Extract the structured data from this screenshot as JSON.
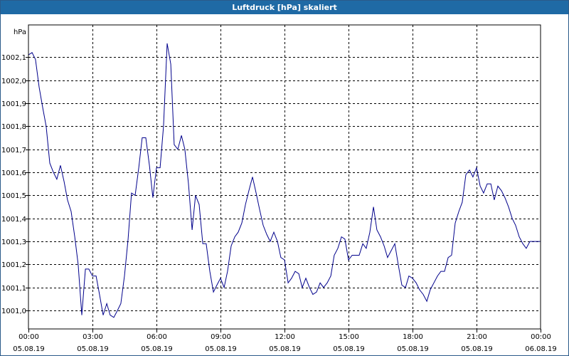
{
  "window": {
    "title": "Luftdruck [hPa] skaliert"
  },
  "chart_data": {
    "type": "line",
    "title": "Luftdruck [hPa] skaliert",
    "ylabel": "hPa",
    "xlabel": "",
    "xlim_hours": [
      0,
      24
    ],
    "ylim": [
      1000.92,
      1002.24
    ],
    "grid": true,
    "y_ticks": [
      {
        "value": 1001.0,
        "label": "1001,0"
      },
      {
        "value": 1001.1,
        "label": "1001,1"
      },
      {
        "value": 1001.2,
        "label": "1001,2"
      },
      {
        "value": 1001.3,
        "label": "1001,3"
      },
      {
        "value": 1001.4,
        "label": "1001,4"
      },
      {
        "value": 1001.5,
        "label": "1001,5"
      },
      {
        "value": 1001.6,
        "label": "1001,6"
      },
      {
        "value": 1001.7,
        "label": "1001,7"
      },
      {
        "value": 1001.8,
        "label": "1001,8"
      },
      {
        "value": 1001.9,
        "label": "1001,9"
      },
      {
        "value": 1002.0,
        "label": "1002,0"
      },
      {
        "value": 1002.1,
        "label": "1002,1"
      }
    ],
    "x_ticks": [
      {
        "hour": 0,
        "time": "00:00",
        "date": "05.08.19"
      },
      {
        "hour": 3,
        "time": "03:00",
        "date": "05.08.19"
      },
      {
        "hour": 6,
        "time": "06:00",
        "date": "05.08.19"
      },
      {
        "hour": 9,
        "time": "09:00",
        "date": "05.08.19"
      },
      {
        "hour": 12,
        "time": "12:00",
        "date": "05.08.19"
      },
      {
        "hour": 15,
        "time": "15:00",
        "date": "05.08.19"
      },
      {
        "hour": 18,
        "time": "18:00",
        "date": "05.08.19"
      },
      {
        "hour": 21,
        "time": "21:00",
        "date": "05.08.19"
      },
      {
        "hour": 24,
        "time": "00:00",
        "date": "06.08.19"
      }
    ],
    "line_color": "#00008b",
    "series": [
      {
        "x": [
          0,
          0.17,
          0.33,
          0.5,
          0.67,
          0.83,
          1.0,
          1.17,
          1.33,
          1.5,
          1.67,
          1.83,
          2.0,
          2.17,
          2.33,
          2.5,
          2.67,
          2.83,
          3.0,
          3.17,
          3.33,
          3.5,
          3.67,
          3.83,
          4.0,
          4.17,
          4.33,
          4.5,
          4.67,
          4.83,
          5.0,
          5.17,
          5.33,
          5.5,
          5.67,
          5.83,
          6.0,
          6.17,
          6.33,
          6.5,
          6.67,
          6.83,
          7.0,
          7.17,
          7.33,
          7.5,
          7.67,
          7.83,
          8.0,
          8.17,
          8.33,
          8.5,
          8.67,
          8.83,
          9.0,
          9.17,
          9.33,
          9.5,
          9.67,
          9.83,
          10.0,
          10.17,
          10.33,
          10.5,
          10.67,
          10.83,
          11.0,
          11.17,
          11.33,
          11.5,
          11.67,
          11.83,
          12.0,
          12.17,
          12.33,
          12.5,
          12.67,
          12.83,
          13.0,
          13.17,
          13.33,
          13.5,
          13.67,
          13.83,
          14.0,
          14.17,
          14.33,
          14.5,
          14.67,
          14.83,
          15.0,
          15.17,
          15.33,
          15.5,
          15.67,
          15.83,
          16.0,
          16.17,
          16.33,
          16.5,
          16.67,
          16.83,
          17.0,
          17.17,
          17.33,
          17.5,
          17.67,
          17.83,
          18.0,
          18.17,
          18.33,
          18.5,
          18.67,
          18.83,
          19.0,
          19.17,
          19.33,
          19.5,
          19.67,
          19.83,
          20.0,
          20.17,
          20.33,
          20.5,
          20.67,
          20.83,
          21.0,
          21.17,
          21.33,
          21.5,
          21.67,
          21.83,
          22.0,
          22.17,
          22.33,
          22.5,
          22.67,
          22.83,
          23.0,
          23.17,
          23.33,
          23.5,
          23.67,
          23.83,
          24.0
        ],
        "y": [
          1002.11,
          1002.12,
          1002.09,
          1001.97,
          1001.88,
          1001.8,
          1001.64,
          1001.6,
          1001.57,
          1001.63,
          1001.56,
          1001.48,
          1001.43,
          1001.32,
          1001.2,
          1000.98,
          1001.18,
          1001.18,
          1001.15,
          1001.15,
          1001.07,
          1000.98,
          1001.03,
          1000.98,
          1000.97,
          1001.0,
          1001.03,
          1001.15,
          1001.31,
          1001.51,
          1001.5,
          1001.62,
          1001.75,
          1001.75,
          1001.63,
          1001.49,
          1001.62,
          1001.62,
          1001.8,
          1002.16,
          1002.07,
          1001.72,
          1001.7,
          1001.76,
          1001.7,
          1001.55,
          1001.35,
          1001.5,
          1001.46,
          1001.29,
          1001.29,
          1001.17,
          1001.08,
          1001.11,
          1001.14,
          1001.1,
          1001.17,
          1001.28,
          1001.32,
          1001.34,
          1001.38,
          1001.46,
          1001.52,
          1001.58,
          1001.51,
          1001.44,
          1001.37,
          1001.33,
          1001.3,
          1001.34,
          1001.3,
          1001.23,
          1001.22,
          1001.12,
          1001.14,
          1001.17,
          1001.16,
          1001.1,
          1001.14,
          1001.1,
          1001.07,
          1001.08,
          1001.12,
          1001.1,
          1001.12,
          1001.15,
          1001.24,
          1001.27,
          1001.32,
          1001.31,
          1001.22,
          1001.24,
          1001.24,
          1001.24,
          1001.29,
          1001.27,
          1001.34,
          1001.45,
          1001.35,
          1001.32,
          1001.28,
          1001.23,
          1001.26,
          1001.29,
          1001.2,
          1001.11,
          1001.1,
          1001.15,
          1001.14,
          1001.12,
          1001.09,
          1001.07,
          1001.04,
          1001.09,
          1001.12,
          1001.15,
          1001.17,
          1001.17,
          1001.23,
          1001.24,
          1001.38,
          1001.43,
          1001.47,
          1001.59,
          1001.61,
          1001.58,
          1001.62,
          1001.54,
          1001.51,
          1001.55,
          1001.55,
          1001.48,
          1001.54,
          1001.52,
          1001.49,
          1001.45,
          1001.4,
          1001.37,
          1001.32,
          1001.29,
          1001.27,
          1001.3,
          1001.3,
          1001.3,
          1001.3
        ]
      }
    ]
  }
}
